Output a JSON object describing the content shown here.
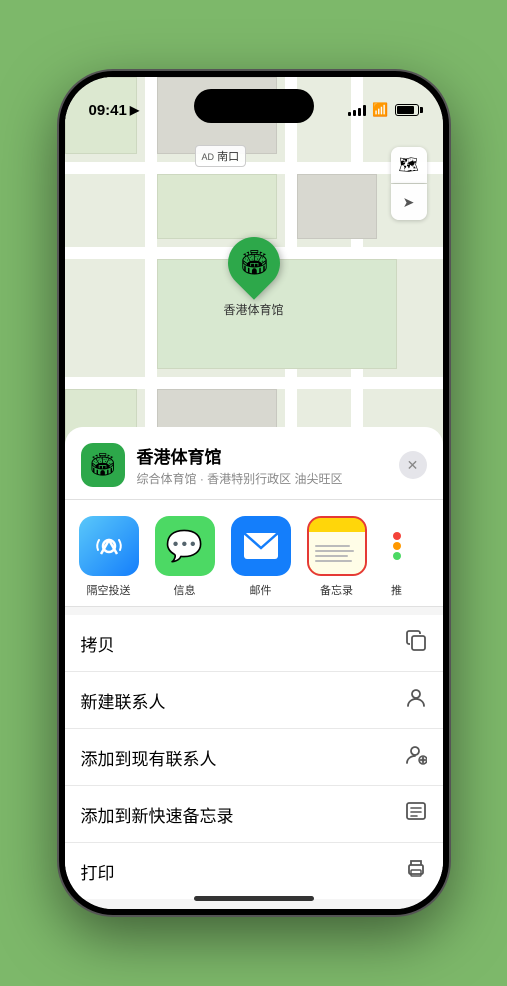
{
  "statusBar": {
    "time": "09:41",
    "locationIcon": "▶"
  },
  "map": {
    "label": "南口",
    "labelPrefix": "AD"
  },
  "marker": {
    "label": "香港体育馆",
    "emoji": "🏟"
  },
  "mapControls": [
    {
      "icon": "🗺",
      "name": "map-type"
    },
    {
      "icon": "➤",
      "name": "location"
    }
  ],
  "venue": {
    "name": "香港体育馆",
    "description": "综合体育馆 · 香港特别行政区 油尖旺区",
    "iconEmoji": "🏟"
  },
  "shareItems": [
    {
      "label": "隔空投送",
      "type": "airdrop"
    },
    {
      "label": "信息",
      "type": "messages"
    },
    {
      "label": "邮件",
      "type": "mail"
    },
    {
      "label": "备忘录",
      "type": "notes"
    },
    {
      "label": "推",
      "type": "more"
    }
  ],
  "actions": [
    {
      "label": "拷贝",
      "iconUnicode": "⎘",
      "name": "copy"
    },
    {
      "label": "新建联系人",
      "iconUnicode": "👤",
      "name": "new-contact"
    },
    {
      "label": "添加到现有联系人",
      "iconUnicode": "👤",
      "name": "add-existing-contact"
    },
    {
      "label": "添加到新快速备忘录",
      "iconUnicode": "📋",
      "name": "add-quick-note"
    },
    {
      "label": "打印",
      "iconUnicode": "🖨",
      "name": "print"
    }
  ]
}
